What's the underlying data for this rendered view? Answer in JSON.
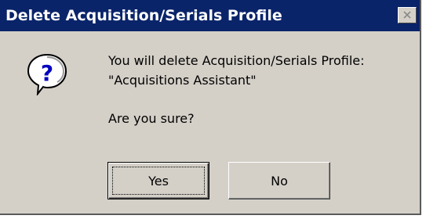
{
  "window": {
    "title": "Delete  Acquisition/Serials Profile"
  },
  "icons": {
    "close": "close-icon",
    "question": "question-icon"
  },
  "message": {
    "line1": "You will delete  Acquisition/Serials Profile:",
    "line2": "\"Acquisitions Assistant\"",
    "line3": "Are you sure?"
  },
  "buttons": {
    "yes_label": "Yes",
    "no_label": "No"
  },
  "colors": {
    "titlebar": "#0a246a",
    "dialog_bg": "#d4d0c8",
    "icon_blue": "#0000c0"
  }
}
